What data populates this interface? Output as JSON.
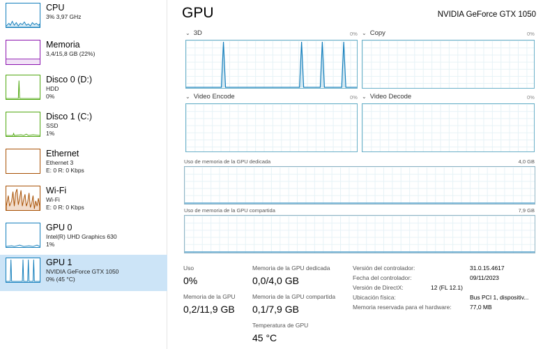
{
  "sidebar": {
    "items": [
      {
        "title": "CPU",
        "line1": "3% 3,97 GHz",
        "line2": "",
        "line3": "",
        "color": "#117dbb"
      },
      {
        "title": "Memoria",
        "line1": "3,4/15,8 GB (22%)",
        "line2": "",
        "line3": "",
        "color": "#8b12ae"
      },
      {
        "title": "Disco 0 (D:)",
        "line1": "HDD",
        "line2": "0%",
        "line3": "",
        "color": "#4da60c"
      },
      {
        "title": "Disco 1 (C:)",
        "line1": "SSD",
        "line2": "1%",
        "line3": "",
        "color": "#4da60c"
      },
      {
        "title": "Ethernet",
        "line1": "Ethernet 3",
        "line2": "E: 0 R: 0 Kbps",
        "line3": "",
        "color": "#a74f01"
      },
      {
        "title": "Wi-Fi",
        "line1": "Wi-Fi",
        "line2": "E: 0 R: 0 Kbps",
        "line3": "",
        "color": "#a74f01"
      },
      {
        "title": "GPU 0",
        "line1": "Intel(R) UHD Graphics 630",
        "line2": "1%",
        "line3": "",
        "color": "#117dbb"
      },
      {
        "title": "GPU 1",
        "line1": "NVIDIA GeForce GTX 1050",
        "line2": "0% (45 °C)",
        "line3": "",
        "color": "#117dbb"
      }
    ]
  },
  "main": {
    "title": "GPU",
    "device": "NVIDIA GeForce GTX 1050",
    "engines": [
      {
        "label": "3D",
        "pct": "0%"
      },
      {
        "label": "Copy",
        "pct": "0%"
      },
      {
        "label": "Video Encode",
        "pct": "0%"
      },
      {
        "label": "Video Decode",
        "pct": "0%"
      }
    ],
    "dedicated": {
      "label": "Uso de memoria de la GPU dedicada",
      "max": "4,0 GB"
    },
    "shared": {
      "label": "Uso de memoria de la GPU compartida",
      "max": "7,9 GB"
    }
  },
  "stats": {
    "uso_label": "Uso",
    "uso_value": "0%",
    "dedicada_label": "Memoria de la GPU dedicada",
    "dedicada_value": "0,0/4,0 GB",
    "memoria_label": "Memoria de la GPU",
    "memoria_value": "0,2/11,9 GB",
    "compartida_label": "Memoria de la GPU compartida",
    "compartida_value": "0,1/7,9 GB",
    "temp_label": "Temperatura de GPU",
    "temp_value": "45 °C"
  },
  "info": {
    "driver_version_key": "Versión del controlador:",
    "driver_version": "31.0.15.4617",
    "driver_date_key": "Fecha del controlador:",
    "driver_date": "09/11/2023",
    "directx_key": "Versión de DirectX:",
    "directx": "12 (FL 12.1)",
    "location_key": "Ubicación física:",
    "location": "Bus PCI 1, dispositiv...",
    "reserved_key": "Memoria reservada para el hardware:",
    "reserved": "77,0 MB"
  }
}
